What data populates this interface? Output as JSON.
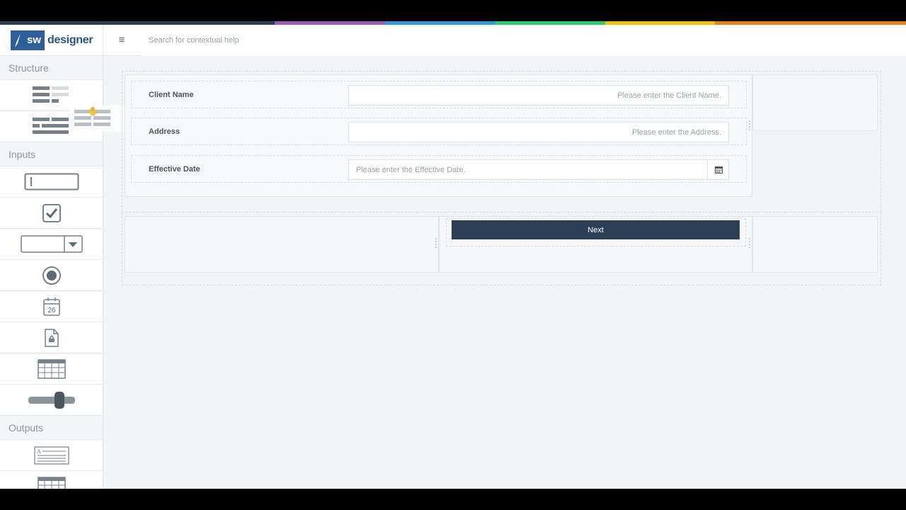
{
  "colors": {
    "strip": [
      "#2c3e55",
      "#9b59b6",
      "#3498db",
      "#2ecc71",
      "#f1c40f",
      "#e67e22"
    ],
    "brand": "#2f5f9a",
    "primary_button": "#2c3e55"
  },
  "header": {
    "logo_mark": "sw",
    "logo_text": "designer",
    "menu_icon": "hamburger-icon",
    "search_placeholder": "Search for contextual help"
  },
  "sidebar": {
    "sections": [
      {
        "title": "Structure",
        "tools": [
          "panel-layout-icon",
          "grid-layout-icon"
        ]
      },
      {
        "title": "Inputs",
        "tools": [
          "text-input-icon",
          "checkbox-icon",
          "dropdown-icon",
          "radio-icon",
          "calendar-icon",
          "file-upload-icon",
          "table-input-icon",
          "slider-icon"
        ]
      },
      {
        "title": "Outputs",
        "tools": [
          "text-output-icon",
          "table-output-icon"
        ]
      }
    ],
    "calendar_day": "26"
  },
  "form": {
    "fields": [
      {
        "label": "Client Name",
        "placeholder": "Please enter the Client Name."
      },
      {
        "label": "Address",
        "placeholder": "Please enter the Address."
      },
      {
        "label": "Effective Date",
        "placeholder": "Please enter the Effective Date."
      }
    ],
    "next_label": "Next"
  }
}
